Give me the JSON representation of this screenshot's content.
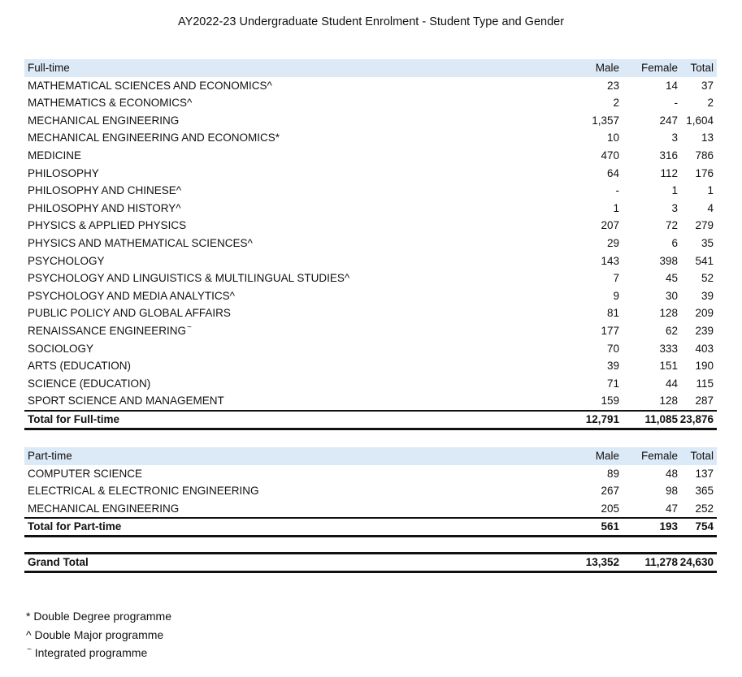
{
  "title": "AY2022-23 Undergraduate Student Enrolment - Student Type and Gender",
  "fulltime": {
    "header": {
      "label": "Full-time",
      "male": "Male",
      "female": "Female",
      "total": "Total"
    },
    "rows": [
      {
        "name": "MATHEMATICAL SCIENCES AND ECONOMICS^",
        "male": "23",
        "female": "14",
        "total": "37"
      },
      {
        "name": "MATHEMATICS & ECONOMICS^",
        "male": "2",
        "female": "-",
        "total": "2"
      },
      {
        "name": "MECHANICAL ENGINEERING",
        "male": "1,357",
        "female": "247",
        "total": "1,604"
      },
      {
        "name": "MECHANICAL ENGINEERING AND ECONOMICS*",
        "male": "10",
        "female": "3",
        "total": "13"
      },
      {
        "name": "MEDICINE",
        "male": "470",
        "female": "316",
        "total": "786"
      },
      {
        "name": "PHILOSOPHY",
        "male": "64",
        "female": "112",
        "total": "176"
      },
      {
        "name": "PHILOSOPHY AND CHINESE^",
        "male": "-",
        "female": "1",
        "total": "1"
      },
      {
        "name": "PHILOSOPHY AND HISTORY^",
        "male": "1",
        "female": "3",
        "total": "4"
      },
      {
        "name": "PHYSICS & APPLIED PHYSICS",
        "male": "207",
        "female": "72",
        "total": "279"
      },
      {
        "name": "PHYSICS AND MATHEMATICAL SCIENCES^",
        "male": "29",
        "female": "6",
        "total": "35"
      },
      {
        "name": "PSYCHOLOGY",
        "male": "143",
        "female": "398",
        "total": "541"
      },
      {
        "name": "PSYCHOLOGY AND LINGUISTICS & MULTILINGUAL STUDIES^",
        "male": "7",
        "female": "45",
        "total": "52"
      },
      {
        "name": "PSYCHOLOGY AND MEDIA ANALYTICS^",
        "male": "9",
        "female": "30",
        "total": "39"
      },
      {
        "name": "PUBLIC POLICY AND GLOBAL AFFAIRS",
        "male": "81",
        "female": "128",
        "total": "209"
      },
      {
        "name": "RENAISSANCE ENGINEERING",
        "sup": "~",
        "male": "177",
        "female": "62",
        "total": "239"
      },
      {
        "name": "SOCIOLOGY",
        "male": "70",
        "female": "333",
        "total": "403"
      },
      {
        "name": "ARTS (EDUCATION)",
        "male": "39",
        "female": "151",
        "total": "190"
      },
      {
        "name": "SCIENCE (EDUCATION)",
        "male": "71",
        "female": "44",
        "total": "115"
      },
      {
        "name": "SPORT SCIENCE AND MANAGEMENT",
        "male": "159",
        "female": "128",
        "total": "287"
      }
    ],
    "total": {
      "label": "Total for Full-time",
      "male": "12,791",
      "female": "11,085",
      "total": "23,876"
    }
  },
  "parttime": {
    "header": {
      "label": "Part-time",
      "male": "Male",
      "female": "Female",
      "total": "Total"
    },
    "rows": [
      {
        "name": "COMPUTER SCIENCE",
        "male": "89",
        "female": "48",
        "total": "137"
      },
      {
        "name": "ELECTRICAL & ELECTRONIC ENGINEERING",
        "male": "267",
        "female": "98",
        "total": "365"
      },
      {
        "name": "MECHANICAL ENGINEERING",
        "male": "205",
        "female": "47",
        "total": "252"
      }
    ],
    "total": {
      "label": "Total for Part-time",
      "male": "561",
      "female": "193",
      "total": "754"
    }
  },
  "grand_total": {
    "label": "Grand Total",
    "male": "13,352",
    "female": "11,278",
    "total": "24,630"
  },
  "notes": {
    "n1": "* Double Degree programme",
    "n2": "^ Double Major programme",
    "n3_mark": "~",
    "n3": "Integrated programme"
  }
}
